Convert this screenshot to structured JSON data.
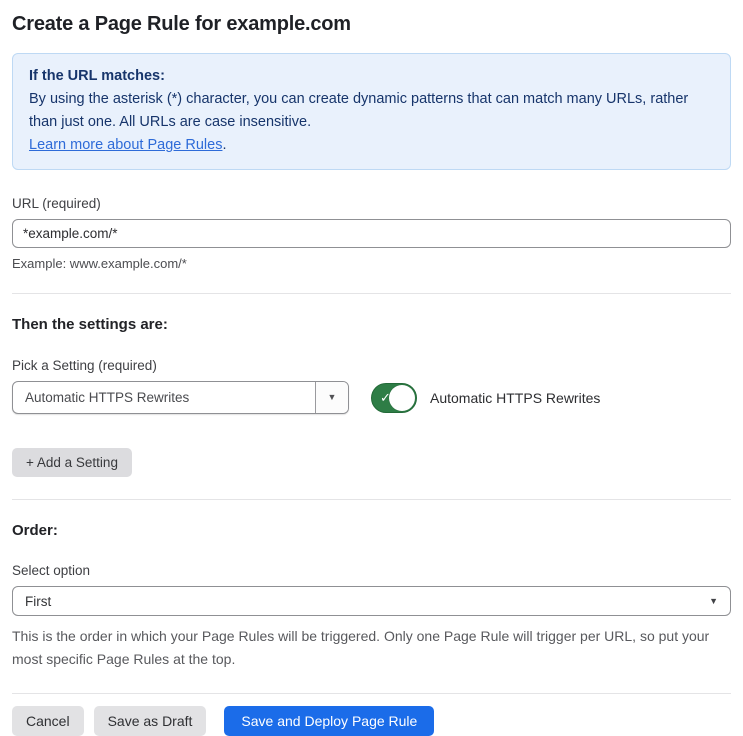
{
  "page": {
    "title": "Create a Page Rule for example.com"
  },
  "info_box": {
    "heading": "If the URL matches:",
    "body": "By using the asterisk (*) character, you can create dynamic patterns that can match many URLs, rather than just one. All URLs are case insensitive.",
    "link": "Learn more about Page Rules",
    "link_suffix": "."
  },
  "url_field": {
    "label": "URL (required)",
    "value": "*example.com/*",
    "helper": "Example: www.example.com/*"
  },
  "settings_section": {
    "heading": "Then the settings are:",
    "picker_label": "Pick a Setting (required)",
    "picker_value": "Automatic HTTPS Rewrites",
    "toggle_label": "Automatic HTTPS Rewrites",
    "toggle_state": "on",
    "add_setting_label": "+ Add a Setting"
  },
  "order_section": {
    "heading": "Order:",
    "select_label": "Select option",
    "select_value": "First",
    "helper": "This is the order in which your Page Rules will be triggered. Only one Page Rule will trigger per URL, so put your most specific Page Rules at the top."
  },
  "footer": {
    "cancel_label": "Cancel",
    "save_draft_label": "Save as Draft",
    "save_deploy_label": "Save and Deploy Page Rule"
  },
  "icons": {
    "dropdown_arrow": "▼",
    "select_arrow": "▼",
    "check": "✓"
  },
  "colors": {
    "accent_blue": "#1b6ce9",
    "info_bg": "#e9f1fc",
    "info_border": "#bed9f4",
    "info_text": "#17356b",
    "link_blue": "#2e6bd8",
    "toggle_green": "#2e7d46",
    "button_gray": "#e2e2e4"
  }
}
